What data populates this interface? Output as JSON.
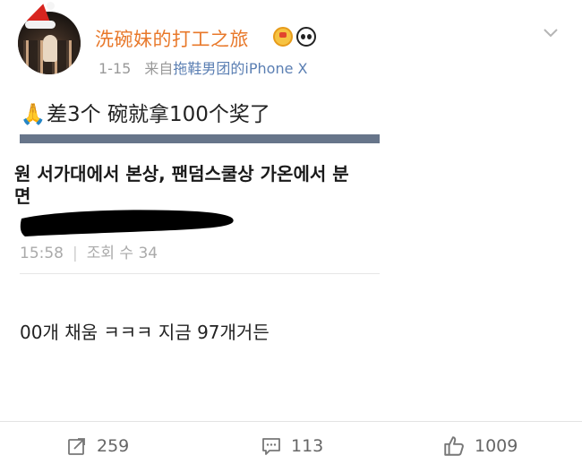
{
  "post": {
    "username": "洗碗妹的打工之旅",
    "date": "1-15",
    "source_prefix": "来自",
    "source": "拖鞋男团的iPhone X",
    "text": "差3个  碗就拿100个奖了",
    "badges": [
      "crown-badge-icon",
      "panda-badge-icon"
    ]
  },
  "embed": {
    "title_line1": "원 서가대에서 본상, 팬덤스쿨상 가온에서 분",
    "title_line2": "면",
    "meta_time": "15:58",
    "meta_views": "조회 수 34",
    "comment": "00개 채움 ㅋㅋㅋ 지금 97개거든"
  },
  "actions": {
    "repost_count": "259",
    "comment_count": "113",
    "like_count": "1009"
  },
  "colors": {
    "username": "#e8782a",
    "source_link": "#5b7fb3",
    "embed_bar": "#67758a"
  }
}
